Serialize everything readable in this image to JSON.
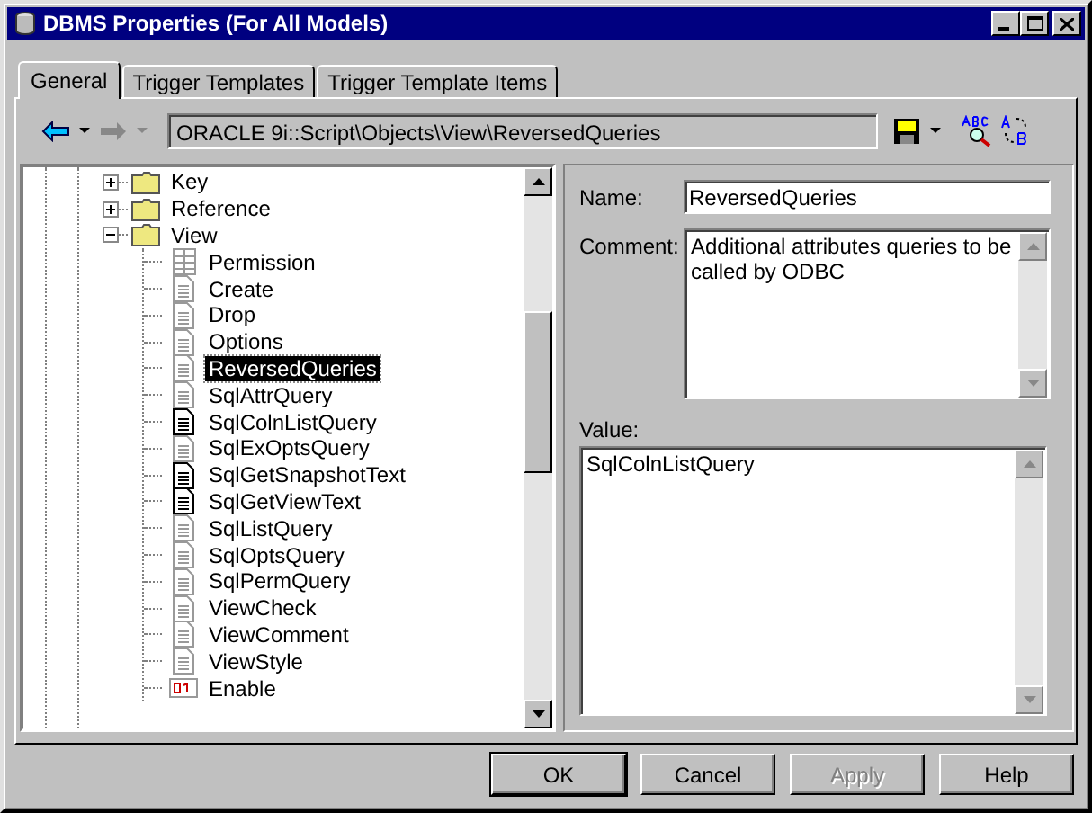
{
  "window": {
    "title": "DBMS Properties (For All Models)"
  },
  "tabs": [
    {
      "label": "General",
      "selected": true
    },
    {
      "label": "Trigger Templates",
      "selected": false
    },
    {
      "label": "Trigger Template Items",
      "selected": false
    }
  ],
  "toolbar": {
    "back_disabled": false,
    "forward_disabled": true,
    "path": "ORACLE 9i::Script\\Objects\\View\\ReversedQueries"
  },
  "tree": [
    {
      "label": "Key",
      "kind": "folder",
      "expanded": false,
      "selected": false
    },
    {
      "label": "Reference",
      "kind": "folder",
      "expanded": false,
      "selected": false
    },
    {
      "label": "View",
      "kind": "folder",
      "expanded": true,
      "selected": false,
      "children": [
        {
          "label": "Permission",
          "kind": "grid",
          "selected": false
        },
        {
          "label": "Create",
          "kind": "document",
          "selected": false
        },
        {
          "label": "Drop",
          "kind": "document",
          "selected": false
        },
        {
          "label": "Options",
          "kind": "document",
          "selected": false
        },
        {
          "label": "ReversedQueries",
          "kind": "document",
          "selected": true
        },
        {
          "label": "SqlAttrQuery",
          "kind": "document",
          "selected": false
        },
        {
          "label": "SqlColnListQuery",
          "kind": "document_modified",
          "selected": false
        },
        {
          "label": "SqlExOptsQuery",
          "kind": "document",
          "selected": false
        },
        {
          "label": "SqlGetSnapshotText",
          "kind": "document_modified",
          "selected": false
        },
        {
          "label": "SqlGetViewText",
          "kind": "document_modified",
          "selected": false
        },
        {
          "label": "SqlListQuery",
          "kind": "document",
          "selected": false
        },
        {
          "label": "SqlOptsQuery",
          "kind": "document",
          "selected": false
        },
        {
          "label": "SqlPermQuery",
          "kind": "document",
          "selected": false
        },
        {
          "label": "ViewCheck",
          "kind": "document",
          "selected": false
        },
        {
          "label": "ViewComment",
          "kind": "document",
          "selected": false
        },
        {
          "label": "ViewStyle",
          "kind": "document",
          "selected": false
        },
        {
          "label": "Enable",
          "kind": "boolean",
          "selected": false
        }
      ]
    }
  ],
  "properties": {
    "name_label": "Name:",
    "name_value": "ReversedQueries",
    "comment_label": "Comment:",
    "comment_value": "Additional attributes queries to be called by ODBC",
    "value_label": "Value:",
    "value_value": "SqlColnListQuery"
  },
  "buttons": [
    {
      "label": "OK",
      "default": true,
      "disabled": false
    },
    {
      "label": "Cancel",
      "default": false,
      "disabled": false
    },
    {
      "label": "Apply",
      "default": false,
      "disabled": true
    },
    {
      "label": "Help",
      "default": false,
      "disabled": false
    }
  ]
}
